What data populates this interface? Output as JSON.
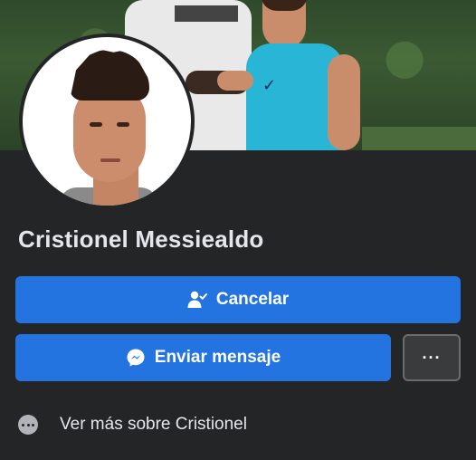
{
  "profile": {
    "name": "Cristionel Messiealdo"
  },
  "actions": {
    "cancel_label": "Cancelar",
    "message_label": "Enviar mensaje",
    "more_label": "···"
  },
  "info": {
    "see_more_label": "Ver más sobre Cristionel"
  },
  "colors": {
    "background": "#242526",
    "primary_button": "#2374e1",
    "secondary_button": "#3a3b3c",
    "text_primary": "#e4e6eb"
  },
  "icons": {
    "cancel": "friend-request-sent-icon",
    "message": "messenger-icon",
    "more": "more-dots-icon",
    "see_more": "more-circle-icon"
  }
}
